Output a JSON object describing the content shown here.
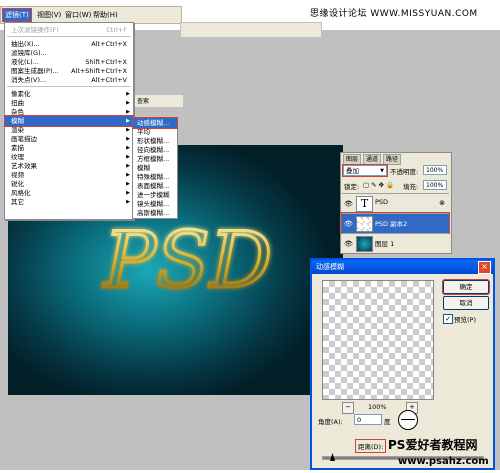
{
  "site_title": "思缘设计论坛 WWW.MISSYUAN.COM",
  "menubar": {
    "filter": "滤镜(T)",
    "view": "视图(V)",
    "window": "窗口(W)",
    "help": "帮助(H)"
  },
  "filter_menu": [
    {
      "label": "上次滤镜操作(F)",
      "shortcut": "Ctrl+F",
      "disabled": true
    },
    {
      "sep": true
    },
    {
      "label": "抽出(X)...",
      "shortcut": "Alt+Ctrl+X"
    },
    {
      "label": "滤镜库(G)..."
    },
    {
      "label": "液化(L)...",
      "shortcut": "Shift+Ctrl+X"
    },
    {
      "label": "图案生成器(P)...",
      "shortcut": "Alt+Shift+Ctrl+X"
    },
    {
      "label": "消失点(V)...",
      "shortcut": "Alt+Ctrl+V"
    },
    {
      "sep": true
    },
    {
      "label": "像素化",
      "sub": true
    },
    {
      "label": "扭曲",
      "sub": true
    },
    {
      "label": "杂色",
      "sub": true
    },
    {
      "label": "模糊",
      "sub": true,
      "active": true
    },
    {
      "label": "渲染",
      "sub": true
    },
    {
      "label": "画笔描边",
      "sub": true
    },
    {
      "label": "素描",
      "sub": true
    },
    {
      "label": "纹理",
      "sub": true
    },
    {
      "label": "艺术效果",
      "sub": true
    },
    {
      "label": "视频",
      "sub": true
    },
    {
      "label": "锐化",
      "sub": true
    },
    {
      "label": "风格化",
      "sub": true
    },
    {
      "label": "其它",
      "sub": true
    }
  ],
  "blur_submenu": [
    "动感模糊...",
    "平均",
    "形状模糊...",
    "径向模糊...",
    "方框模糊...",
    "模糊",
    "特殊模糊...",
    "表面模糊...",
    "进一步模糊",
    "镜头模糊...",
    "高斯模糊..."
  ],
  "optbar_text": "查索",
  "canvas_text": "PSD",
  "layers": {
    "tabs": [
      "图层",
      "通道",
      "路径"
    ],
    "blend_mode": "叠加",
    "opacity_label": "不透明度:",
    "opacity": "100%",
    "lock_label": "锁定:",
    "fill_label": "填充:",
    "fill": "100%",
    "items": [
      {
        "name": "PSD",
        "thumb": "T"
      },
      {
        "name": "PSD 副本2"
      },
      {
        "name": "图层 1"
      }
    ]
  },
  "motion_blur": {
    "title": "动感模糊",
    "ok": "确定",
    "cancel": "取消",
    "preview_label": "预览(P)",
    "zoom": "100%",
    "zoom_minus": "−",
    "zoom_plus": "+",
    "angle_label": "角度(A):",
    "angle_value": "0",
    "angle_unit": "度",
    "distance_label": "距离(D):"
  },
  "watermark": {
    "line1": "PS爱好者教程网",
    "line2": "www.psahz.com"
  }
}
